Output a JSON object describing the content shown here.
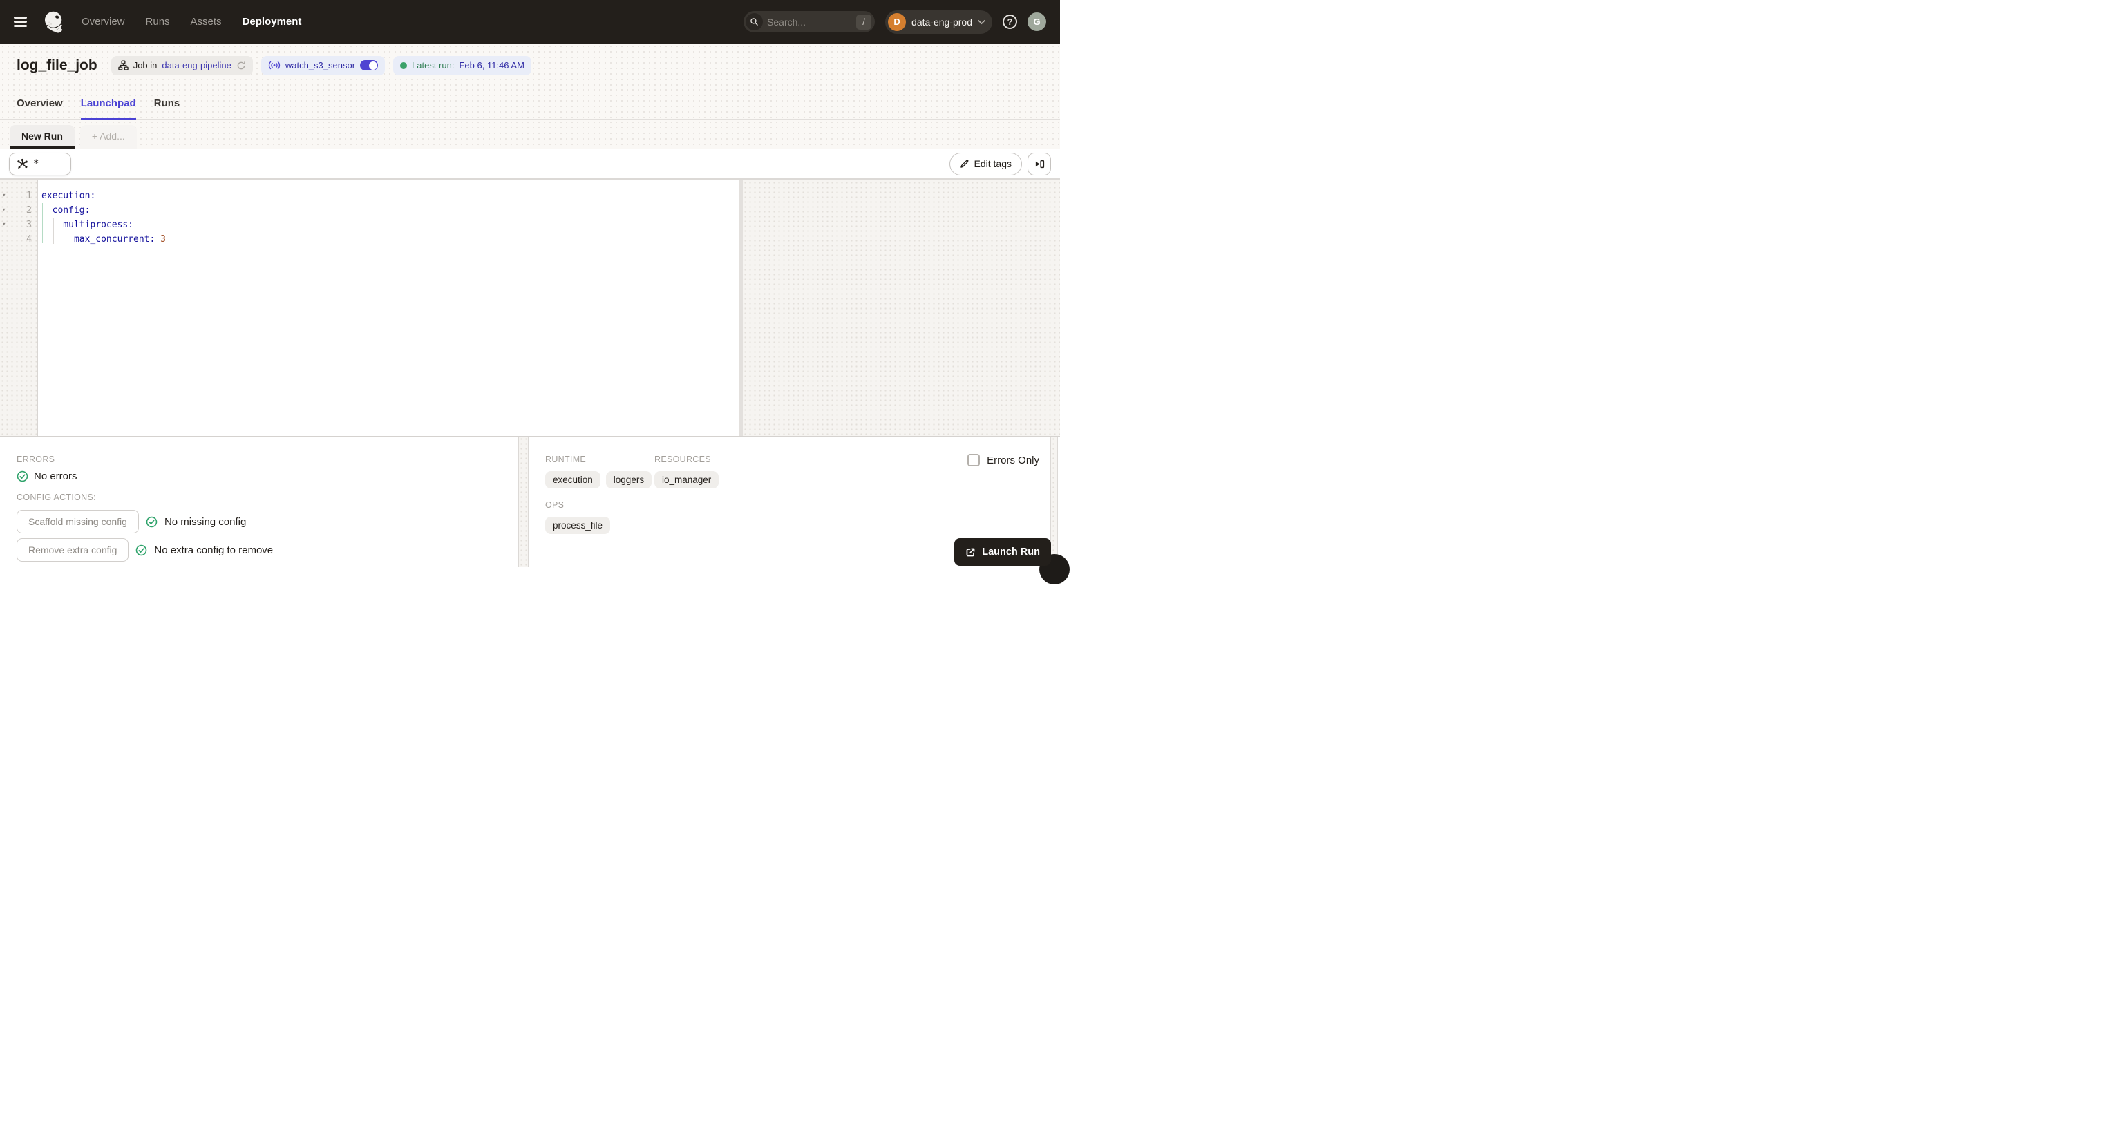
{
  "header": {
    "nav": [
      {
        "label": "Overview"
      },
      {
        "label": "Runs"
      },
      {
        "label": "Assets"
      },
      {
        "label": "Deployment",
        "active": true
      }
    ],
    "search": {
      "placeholder": "Search...",
      "shortcut": "/"
    },
    "workspace": {
      "initial": "D",
      "name": "data-eng-prod"
    },
    "user_initial": "G"
  },
  "title_bar": {
    "title": "log_file_job",
    "job_badge": {
      "prefix": "Job in",
      "link": "data-eng-pipeline"
    },
    "sensor_badge": {
      "label": "watch_s3_sensor",
      "toggle_state": "on"
    },
    "latest_run_badge": {
      "prefix": "Latest run:",
      "value": "Feb 6, 11:46 AM",
      "status": "success"
    }
  },
  "tabs": [
    {
      "label": "Overview"
    },
    {
      "label": "Launchpad",
      "active": true
    },
    {
      "label": "Runs"
    }
  ],
  "launchpad": {
    "run_tabs": {
      "active": "New Run",
      "add": "+ Add..."
    },
    "op_selector": "*",
    "toolbar": {
      "edit_tags_label": "Edit tags"
    },
    "editor": {
      "language": "yaml",
      "lines": [
        {
          "number": 1,
          "indent": 0,
          "key": "execution:",
          "value": "",
          "foldable": true
        },
        {
          "number": 2,
          "indent": 1,
          "key": "config:",
          "value": "",
          "foldable": true
        },
        {
          "number": 3,
          "indent": 2,
          "key": "multiprocess:",
          "value": "",
          "foldable": true
        },
        {
          "number": 4,
          "indent": 3,
          "key": "max_concurrent:",
          "value": "3",
          "foldable": false
        }
      ]
    },
    "bottom_left": {
      "errors_label": "ERRORS",
      "no_errors": "No errors",
      "config_actions_label": "CONFIG ACTIONS:",
      "actions": [
        {
          "button": "Scaffold missing config",
          "status": "No missing config"
        },
        {
          "button": "Remove extra config",
          "status": "No extra config to remove"
        }
      ]
    },
    "bottom_right": {
      "errors_only_label": "Errors Only",
      "errors_only_checked": false,
      "sections": [
        {
          "label": "RUNTIME",
          "chips": [
            "execution",
            "loggers"
          ]
        },
        {
          "label": "RESOURCES",
          "chips": [
            "io_manager"
          ]
        },
        {
          "label": "OPS",
          "chips": [
            "process_file"
          ]
        }
      ],
      "launch_button": "Launch Run"
    }
  },
  "icons": {
    "menu": "hamburger",
    "logo": "dagster-octopus",
    "search": "magnifier",
    "workspace_chevron": "chevron-down",
    "help": "question-circle",
    "job": "workflow-graph",
    "refresh": "circular-arrow",
    "sensor": "radio-waves",
    "sensor_toggle": "switch-on",
    "latest_run_dot": "green-dot",
    "op_selector": "graph-with-arrow",
    "edit_tags": "pencil",
    "expand_panel": "play-into-rect",
    "status_ok": "check-circle",
    "errors_only": "empty-checkbox",
    "launch": "open-in-new",
    "fold": "triangle-down"
  },
  "colors": {
    "header_bg": "#231f1b",
    "accent_indigo": "#4a42d4",
    "link_indigo": "#322da6",
    "success_green": "#2fa36b",
    "latest_run_green": "#2e7d52",
    "badge_blue_bg": "#e9edf8",
    "badge_gray_bg": "#eceae7",
    "chip_bg": "#f0eeeb",
    "yaml_key": "#15129c",
    "yaml_number": "#a4542c",
    "workspace_avatar": "#d57f2f",
    "user_avatar": "#9fa89c",
    "launch_button_bg": "#231f1b"
  }
}
